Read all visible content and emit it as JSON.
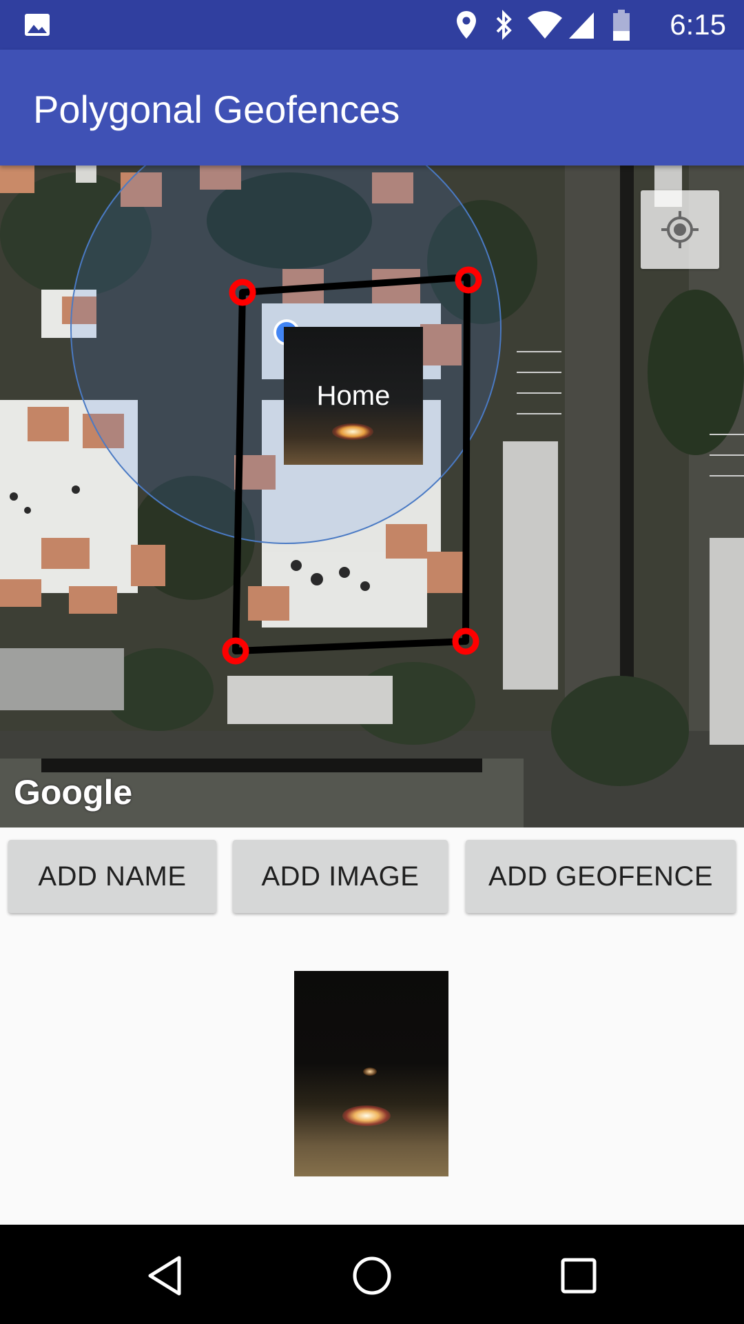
{
  "status_bar": {
    "time": "6:15",
    "icons": [
      "image-icon",
      "location-icon",
      "bluetooth-icon",
      "wifi-icon",
      "signal-icon",
      "battery-icon"
    ]
  },
  "app_bar": {
    "title": "Polygonal Geofences"
  },
  "map": {
    "marker_label": "Home",
    "attribution": "Google",
    "locate_icon": "my-location-icon",
    "geofence_color": "#000000",
    "vertex_color": "#ff0000",
    "radius_color": "#4285f4"
  },
  "buttons": {
    "add_name": "ADD NAME",
    "add_image": "ADD IMAGE",
    "add_geofence": "ADD GEOFENCE"
  },
  "nav_bar": {
    "icons": [
      "back-icon",
      "home-icon",
      "recents-icon"
    ]
  },
  "colors": {
    "status_bar": "#303f9f",
    "app_bar": "#3f51b5",
    "button": "#d6d7d7"
  }
}
